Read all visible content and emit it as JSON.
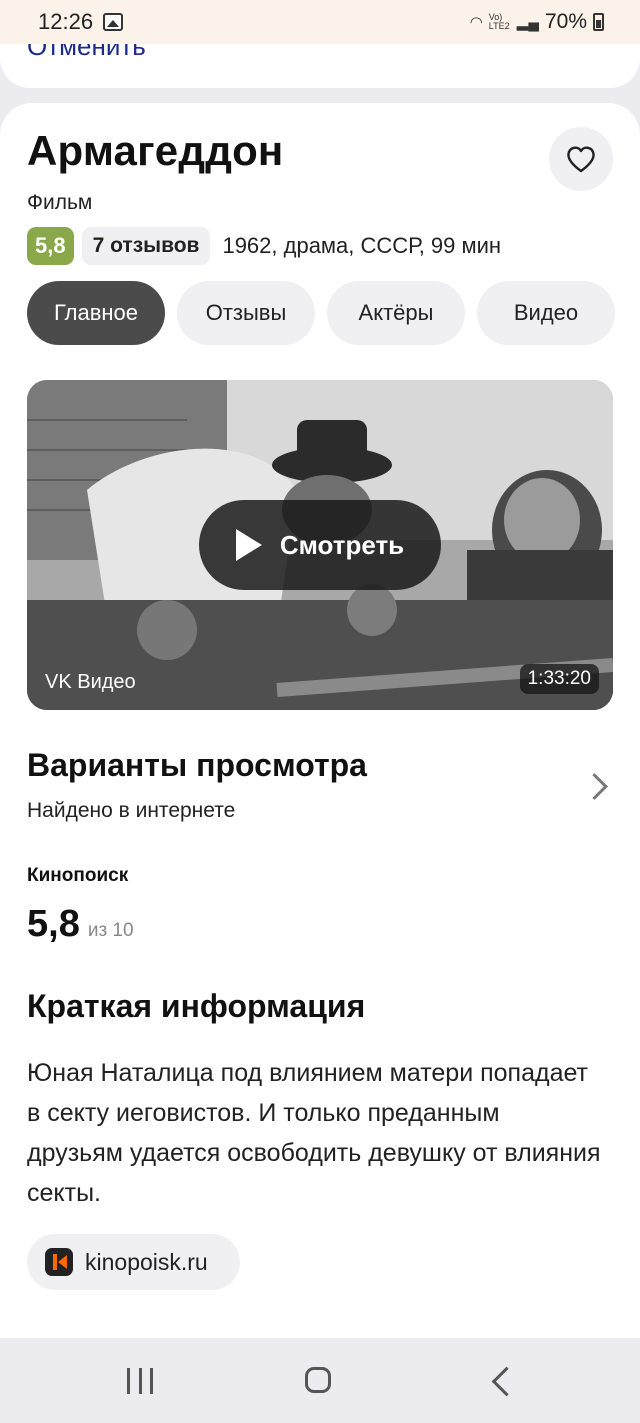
{
  "status_bar": {
    "time": "12:26",
    "network_label": "Vo) LTE2",
    "battery": "70%"
  },
  "top_sheet": {
    "cancel_label": "Отменить"
  },
  "movie": {
    "title": "Армагеддон",
    "type": "Фильм",
    "rating": "5,8",
    "reviews": "7 отзывов",
    "meta": "1962, драма, СССР, 99 мин"
  },
  "tabs": [
    "Главное",
    "Отзывы",
    "Актёры",
    "Видео"
  ],
  "video": {
    "play_label": "Смотреть",
    "source": "VK Видео",
    "duration": "1:33:20"
  },
  "watch": {
    "title": "Варианты просмотра",
    "subtitle": "Найдено в интернете"
  },
  "kinopoisk": {
    "label": "Кинопоиск",
    "score": "5,8",
    "out_of": "из 10"
  },
  "info": {
    "title": "Краткая информация",
    "description": "Юная Наталица под влиянием матери попадает в секту иеговистов. И только преданным друзьям удается освободить девушку от влияния секты.",
    "source": "kinopoisk.ru"
  },
  "colors": {
    "rating_badge": "#8aa84a",
    "active_tab": "#4b4b4b",
    "cancel_link": "#1a2a8a"
  }
}
